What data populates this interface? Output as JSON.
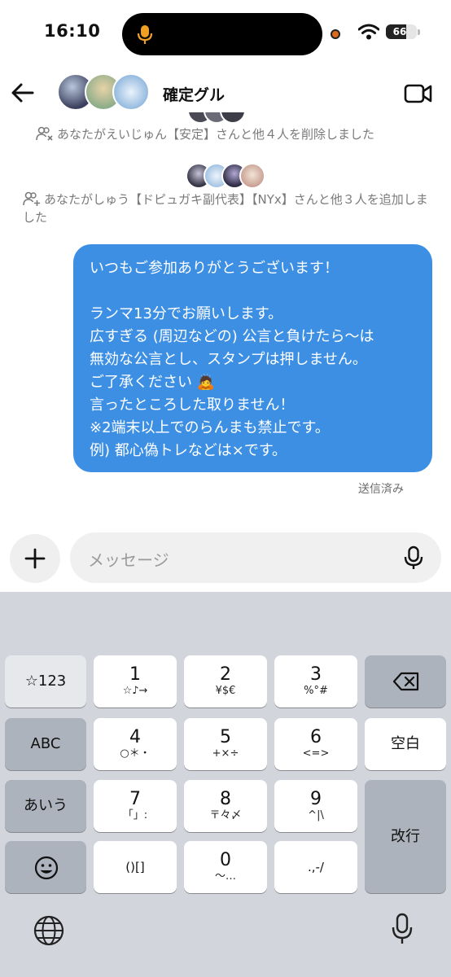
{
  "status_bar": {
    "time": "16:10",
    "battery": "66"
  },
  "header": {
    "title": "確定グル"
  },
  "system_messages": [
    {
      "text": "あなたがえいじゅん【安定】さんと他４人を削除しました",
      "icon": "person-remove-icon"
    },
    {
      "text": "あなたがしゅう【ドピュガキ副代表】【NYx】さんと他３人を追加しました",
      "icon": "person-add-icon"
    }
  ],
  "message": {
    "lines": [
      "いつもご参加ありがとうございます！",
      "",
      "ランマ13分でお願いします。",
      "広すぎる (周辺などの) 公言と負けたら〜は",
      "無効な公言とし、スタンプは押しません。",
      "ご了承ください 🙇",
      "言ったところした取りません！",
      "※2端末以上でのらんまも禁止です。",
      "例) 都心偽トレなどは×です。"
    ],
    "status": "送信済み",
    "bubble_color": "#3d8fe4"
  },
  "composer": {
    "placeholder": "メッセージ"
  },
  "keyboard": {
    "left_keys": [
      "☆123",
      "ABC",
      "あいう"
    ],
    "rows": [
      [
        {
          "main": "1",
          "sub": "☆♪→"
        },
        {
          "main": "2",
          "sub": "¥$€"
        },
        {
          "main": "3",
          "sub": "%°#"
        }
      ],
      [
        {
          "main": "4",
          "sub": "○＊・"
        },
        {
          "main": "5",
          "sub": "+×÷"
        },
        {
          "main": "6",
          "sub": "<=>"
        }
      ],
      [
        {
          "main": "7",
          "sub": "「」:"
        },
        {
          "main": "8",
          "sub": "〒々〆"
        },
        {
          "main": "9",
          "sub": "^|\\"
        }
      ],
      [
        {
          "main": "",
          "sub": "()[]"
        },
        {
          "main": "0",
          "sub": "〜…"
        },
        {
          "main": "",
          "sub": ".,-/"
        }
      ]
    ],
    "space_label": "空白",
    "return_label": "改行"
  }
}
